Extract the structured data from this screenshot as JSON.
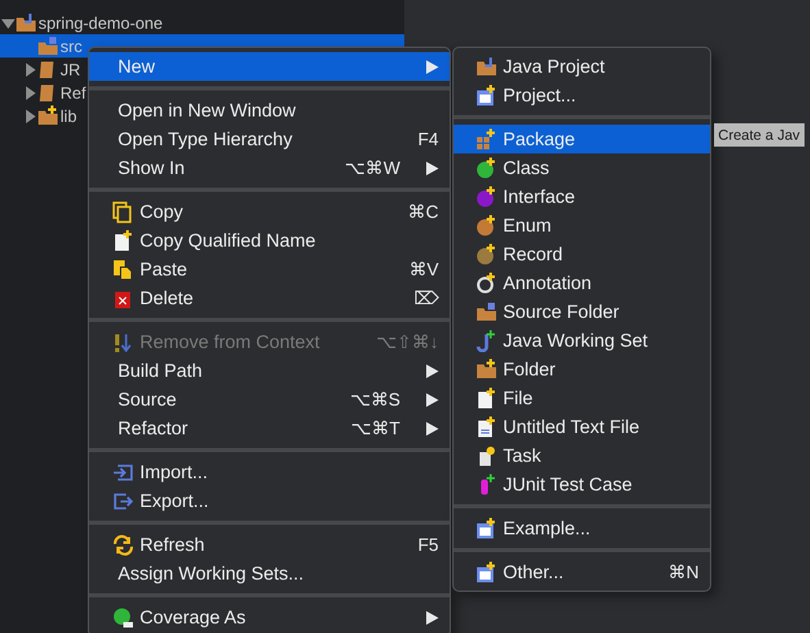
{
  "tree": [
    {
      "label": "spring-demo-one",
      "expanded": true,
      "selected": false,
      "children": [
        {
          "label": "src",
          "selected": true
        },
        {
          "label": "JR",
          "expanded": false,
          "selected": false
        },
        {
          "label": "Ref",
          "expanded": false,
          "selected": false
        },
        {
          "label": "lib",
          "expanded": false,
          "selected": false
        }
      ]
    }
  ],
  "context_menu": [
    {
      "kind": "item",
      "label": "New",
      "submenu": true,
      "selected": true,
      "disabled": false
    },
    {
      "kind": "separator"
    },
    {
      "kind": "item",
      "label": "Open in New Window",
      "selected": false,
      "disabled": false
    },
    {
      "kind": "item",
      "label": "Open Type Hierarchy",
      "shortcut": "F4",
      "selected": false,
      "disabled": false
    },
    {
      "kind": "item",
      "label": "Show In",
      "shortcut": "⌥⌘W",
      "submenu": true,
      "selected": false,
      "disabled": false
    },
    {
      "kind": "separator"
    },
    {
      "kind": "item",
      "label": "Copy",
      "shortcut": "⌘C",
      "selected": false,
      "disabled": false
    },
    {
      "kind": "item",
      "label": "Copy Qualified Name",
      "selected": false,
      "disabled": false
    },
    {
      "kind": "item",
      "label": "Paste",
      "shortcut": "⌘V",
      "selected": false,
      "disabled": false
    },
    {
      "kind": "item",
      "label": "Delete",
      "shortcut": "⌦",
      "selected": false,
      "disabled": false
    },
    {
      "kind": "separator"
    },
    {
      "kind": "item",
      "label": "Remove from Context",
      "shortcut": "⌥⇧⌘↓",
      "selected": false,
      "disabled": true
    },
    {
      "kind": "item",
      "label": "Build Path",
      "submenu": true,
      "selected": false,
      "disabled": false
    },
    {
      "kind": "item",
      "label": "Source",
      "shortcut": "⌥⌘S",
      "submenu": true,
      "selected": false,
      "disabled": false
    },
    {
      "kind": "item",
      "label": "Refactor",
      "shortcut": "⌥⌘T",
      "submenu": true,
      "selected": false,
      "disabled": false
    },
    {
      "kind": "separator"
    },
    {
      "kind": "item",
      "label": "Import...",
      "selected": false,
      "disabled": false
    },
    {
      "kind": "item",
      "label": "Export...",
      "selected": false,
      "disabled": false
    },
    {
      "kind": "separator"
    },
    {
      "kind": "item",
      "label": "Refresh",
      "shortcut": "F5",
      "selected": false,
      "disabled": false
    },
    {
      "kind": "item",
      "label": "Assign Working Sets...",
      "selected": false,
      "disabled": false
    },
    {
      "kind": "separator"
    },
    {
      "kind": "item",
      "label": "Coverage As",
      "submenu": true,
      "selected": false,
      "disabled": false
    }
  ],
  "new_submenu": [
    {
      "kind": "item",
      "label": "Java Project",
      "selected": false,
      "disabled": false
    },
    {
      "kind": "item",
      "label": "Project...",
      "selected": false,
      "disabled": false
    },
    {
      "kind": "separator"
    },
    {
      "kind": "item",
      "label": "Package",
      "selected": true,
      "disabled": false
    },
    {
      "kind": "item",
      "label": "Class",
      "selected": false,
      "disabled": false
    },
    {
      "kind": "item",
      "label": "Interface",
      "selected": false,
      "disabled": false
    },
    {
      "kind": "item",
      "label": "Enum",
      "selected": false,
      "disabled": false
    },
    {
      "kind": "item",
      "label": "Record",
      "selected": false,
      "disabled": false
    },
    {
      "kind": "item",
      "label": "Annotation",
      "selected": false,
      "disabled": false
    },
    {
      "kind": "item",
      "label": "Source Folder",
      "selected": false,
      "disabled": false
    },
    {
      "kind": "item",
      "label": "Java Working Set",
      "selected": false,
      "disabled": false
    },
    {
      "kind": "item",
      "label": "Folder",
      "selected": false,
      "disabled": false
    },
    {
      "kind": "item",
      "label": "File",
      "selected": false,
      "disabled": false
    },
    {
      "kind": "item",
      "label": "Untitled Text File",
      "selected": false,
      "disabled": false
    },
    {
      "kind": "item",
      "label": "Task",
      "selected": false,
      "disabled": false
    },
    {
      "kind": "item",
      "label": "JUnit Test Case",
      "selected": false,
      "disabled": false
    },
    {
      "kind": "separator"
    },
    {
      "kind": "item",
      "label": "Example...",
      "selected": false,
      "disabled": false
    },
    {
      "kind": "separator"
    },
    {
      "kind": "item",
      "label": "Other...",
      "shortcut": "⌘N",
      "selected": false,
      "disabled": false
    }
  ],
  "tooltip": "Create a Jav"
}
